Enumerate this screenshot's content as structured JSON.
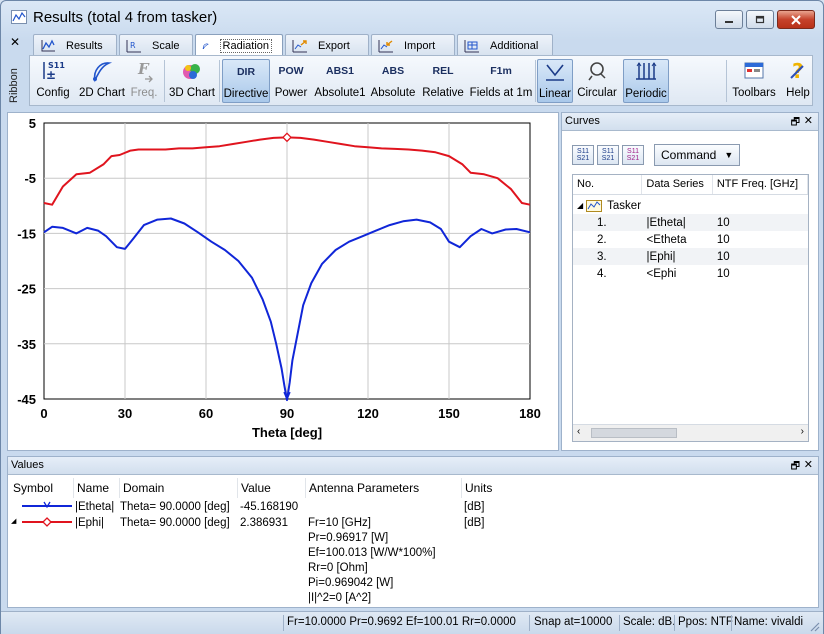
{
  "window": {
    "title": "Results (total 4 from tasker)"
  },
  "ribbon": {
    "side_label": "Ribbon",
    "tabs": [
      {
        "label": "Results",
        "icon": "results-icon"
      },
      {
        "label": "Scale",
        "icon": "scale-icon"
      },
      {
        "label": "Radiation",
        "icon": "radiation-icon",
        "active": true
      },
      {
        "label": "Export",
        "icon": "export-icon"
      },
      {
        "label": "Import",
        "icon": "import-icon"
      },
      {
        "label": "Additional",
        "icon": "additional-icon"
      }
    ],
    "buttons": [
      {
        "label": "Config",
        "icon_text": "S11"
      },
      {
        "label": "2D Chart",
        "icon_text": ""
      },
      {
        "label": "Freq.",
        "icon_text": "F"
      },
      {
        "label": "3D Chart",
        "icon_text": ""
      },
      {
        "label": "Directive",
        "icon_text": "DIR"
      },
      {
        "label": "Power",
        "icon_text": "POW"
      },
      {
        "label": "Absolute1",
        "icon_text": "ABS1"
      },
      {
        "label": "Absolute",
        "icon_text": "ABS"
      },
      {
        "label": "Relative",
        "icon_text": "REL"
      },
      {
        "label": "Fields at 1m",
        "icon_text": "F1m"
      },
      {
        "label": "Linear",
        "icon_text": ""
      },
      {
        "label": "Circular",
        "icon_text": ""
      },
      {
        "label": "Periodic",
        "icon_text": ""
      },
      {
        "label": "Toolbars",
        "icon_text": ""
      },
      {
        "label": "Help",
        "icon_text": "?"
      }
    ]
  },
  "chart_data": {
    "type": "line",
    "xlabel": "Theta [deg]",
    "ylabel": "",
    "xlim": [
      0,
      180
    ],
    "ylim": [
      -45,
      5
    ],
    "x_ticks": [
      0,
      30,
      60,
      90,
      120,
      150,
      180
    ],
    "y_ticks": [
      5,
      -5,
      -15,
      -25,
      -35,
      -45
    ],
    "grid": true,
    "series": [
      {
        "color": "#e0141e",
        "marker_at": 90,
        "x": [
          0,
          3,
          7,
          12,
          17,
          22,
          25,
          28,
          32,
          35,
          40,
          45,
          50,
          55,
          60,
          65,
          70,
          75,
          80,
          85,
          90,
          95,
          100,
          105,
          110,
          115,
          120,
          125,
          130,
          135,
          140,
          145,
          150,
          155,
          158,
          163,
          168,
          173,
          177,
          180
        ],
        "y": [
          -9.5,
          -9.8,
          -6.5,
          -4.3,
          -4.0,
          -2.5,
          -1.0,
          -0.8,
          0.0,
          0.2,
          0.2,
          0.2,
          0.4,
          0.4,
          0.6,
          0.8,
          1.2,
          1.6,
          2.0,
          2.3,
          2.4,
          2.3,
          2.0,
          1.6,
          1.2,
          0.8,
          0.6,
          0.4,
          0.3,
          0.2,
          0.0,
          -0.3,
          -1.0,
          -2.5,
          -4.0,
          -4.3,
          -5.0,
          -7.0,
          -9.5,
          -9.8
        ]
      },
      {
        "color": "#1026d8",
        "marker_at": 90,
        "x": [
          0,
          3,
          7,
          12,
          16,
          20,
          23,
          27,
          30,
          33,
          37,
          42,
          47,
          52,
          57,
          62,
          67,
          72,
          77,
          81,
          84,
          86,
          88,
          89,
          90,
          91,
          92,
          94,
          96,
          99,
          103,
          108,
          113,
          118,
          123,
          128,
          133,
          138,
          143,
          147,
          150,
          154,
          158,
          162,
          166,
          171,
          175,
          180
        ],
        "y": [
          -14.8,
          -13.8,
          -14.0,
          -15.0,
          -14.0,
          -14.5,
          -15.5,
          -17.5,
          -17.8,
          -16.0,
          -13.5,
          -12.5,
          -12.3,
          -13.2,
          -14.8,
          -16.5,
          -18.0,
          -20.0,
          -23.0,
          -27.0,
          -31.0,
          -35.0,
          -39.5,
          -42.5,
          -45.2,
          -42.0,
          -38.0,
          -33.0,
          -28.0,
          -24.0,
          -20.5,
          -18.0,
          -16.5,
          -15.5,
          -14.5,
          -13.5,
          -12.8,
          -12.5,
          -13.0,
          -14.2,
          -16.5,
          -17.5,
          -15.5,
          -14.2,
          -15.0,
          -14.3,
          -14.2,
          -14.8
        ]
      }
    ]
  },
  "curves": {
    "title": "Curves",
    "command_label": "Command",
    "tool_icons": [
      {
        "name": "sort-s11-s21-icon",
        "text": "S11 S21"
      },
      {
        "name": "copy-s11-s21-icon",
        "text": "S11 S21"
      },
      {
        "name": "remove-s11-s21-icon",
        "text": "S11 S21"
      }
    ],
    "columns": [
      "No.",
      "Data Series",
      "NTF Freq. [GHz]"
    ],
    "group": "Tasker",
    "rows": [
      {
        "no": "1.",
        "series": "|Etheta|",
        "freq": "10"
      },
      {
        "no": "2.",
        "series": "<Etheta",
        "freq": "10"
      },
      {
        "no": "3.",
        "series": "|Ephi|",
        "freq": "10"
      },
      {
        "no": "4.",
        "series": "<Ephi",
        "freq": "10"
      }
    ]
  },
  "values": {
    "title": "Values",
    "columns": [
      "Symbol",
      "Name",
      "Domain",
      "Value",
      "Antenna Parameters",
      "Units"
    ],
    "rows": [
      {
        "name": "|Etheta|",
        "domain": "Theta= 90.0000 [deg]",
        "value": "-45.168190",
        "units": "[dB]",
        "color": "#1026d8"
      },
      {
        "name": "|Ephi|",
        "domain": "Theta= 90.0000 [deg]",
        "value": "2.386931",
        "units": "[dB]",
        "color": "#e0141e"
      }
    ],
    "antenna_params": [
      "Fr=10 [GHz]",
      "Pr=0.96917 [W]",
      "Ef=100.013 [W/W*100%]",
      "Rr=0 [Ohm]",
      "Pi=0.969042 [W]",
      "|I|^2=0 [A^2]"
    ]
  },
  "status": {
    "summary": "Fr=10.0000 Pr=0.9692 Ef=100.01 Rr=0.0000",
    "snap": "Snap at=10000",
    "scale": "Scale: dB.",
    "ppos": "Ppos: NTF",
    "name": "Name: vivaldi"
  }
}
